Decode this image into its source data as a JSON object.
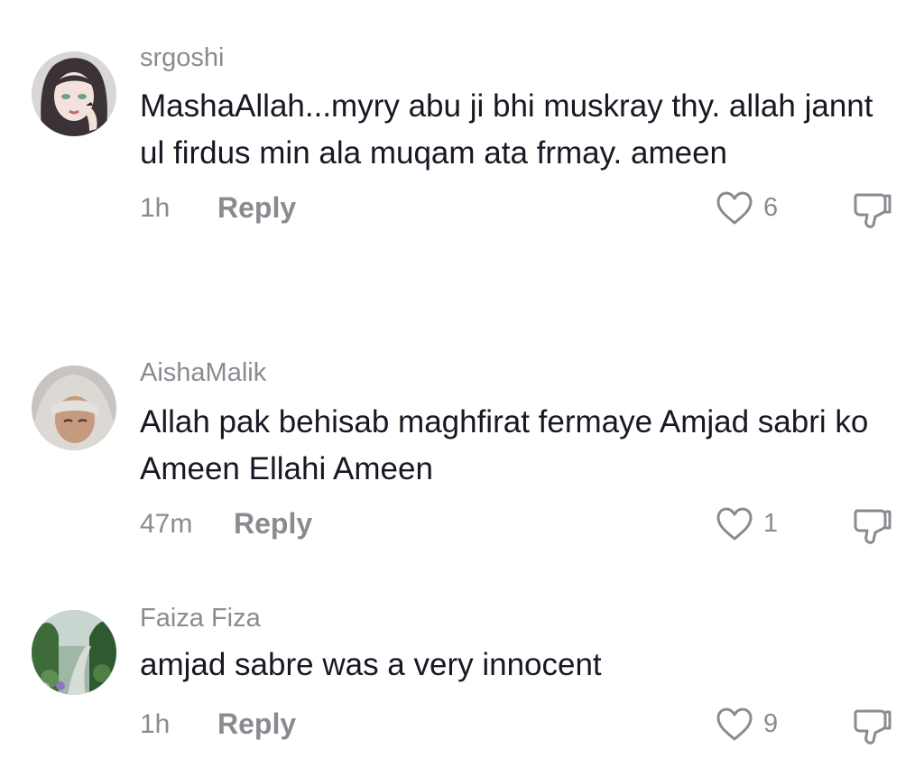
{
  "comments": [
    {
      "username": "srgoshi",
      "text": "MashaAllah...myry abu ji bhi muskray thy. allah jannt ul firdus min ala muqam ata frmay. ameen",
      "time": "1h",
      "reply_label": "Reply",
      "likes": "6",
      "avatar_icon": "illustrated-girl-avatar"
    },
    {
      "username": "AishaMalik",
      "text": "Allah pak behisab maghfirat fermaye Amjad sabri ko Ameen Ellahi Ameen",
      "time": "47m",
      "reply_label": "Reply",
      "likes": "1",
      "avatar_icon": "hijab-woman-avatar"
    },
    {
      "username": "Faiza Fiza",
      "text": "amjad sabre was a very innocent",
      "time": "1h",
      "reply_label": "Reply",
      "likes": "9",
      "avatar_icon": "garden-path-avatar"
    }
  ],
  "colors": {
    "text": "#161823",
    "secondary": "#8a8b91",
    "background": "#ffffff"
  }
}
